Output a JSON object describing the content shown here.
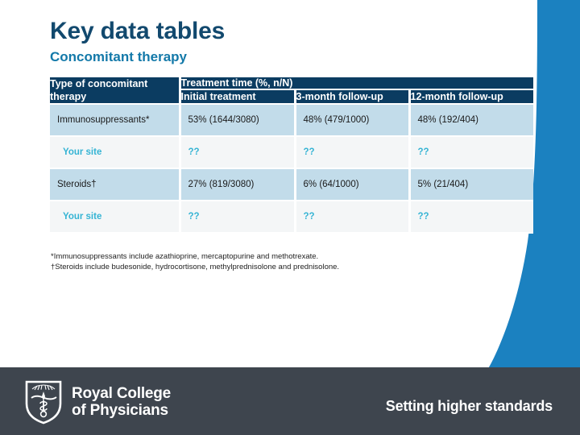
{
  "slide": {
    "title": "Key data tables",
    "subtitle": "Concomitant therapy"
  },
  "colors": {
    "title_navy": "#12496e",
    "subtitle_blue": "#1379a9",
    "header_navy": "#0b3c61",
    "row_band_blue": "#c2dcea",
    "row_site_bg": "#f4f6f7",
    "site_text_cyan": "#35b4d4",
    "accent_blue": "#1b81c0",
    "footer_slate": "#3e454e"
  },
  "table": {
    "col_type_header": "Type of concomitant therapy",
    "group_header": "Treatment time (%, n/N)",
    "sub_headers": [
      "Initial treatment",
      "3-month follow-up",
      "12-month follow-up"
    ],
    "rows": [
      {
        "kind": "data",
        "label": "Immunosuppressants*",
        "values": [
          "53% (1644/3080)",
          "48% (479/1000)",
          "48% (192/404)"
        ]
      },
      {
        "kind": "site",
        "label": "Your site",
        "values": [
          "??",
          "??",
          "??"
        ]
      },
      {
        "kind": "data",
        "label": "Steroids†",
        "values": [
          "27% (819/3080)",
          "6% (64/1000)",
          "5% (21/404)"
        ]
      },
      {
        "kind": "site",
        "label": "Your site",
        "values": [
          "??",
          "??",
          "??"
        ]
      }
    ]
  },
  "footnotes": [
    "*Immunosuppressants include azathioprine, mercaptopurine and methotrexate.",
    "†Steroids include budesonide, hydrocortisone, methylprednisolone and prednisolone."
  ],
  "footer": {
    "logo_line1": "Royal College",
    "logo_line2": "of Physicians",
    "tagline": "Setting higher standards"
  }
}
